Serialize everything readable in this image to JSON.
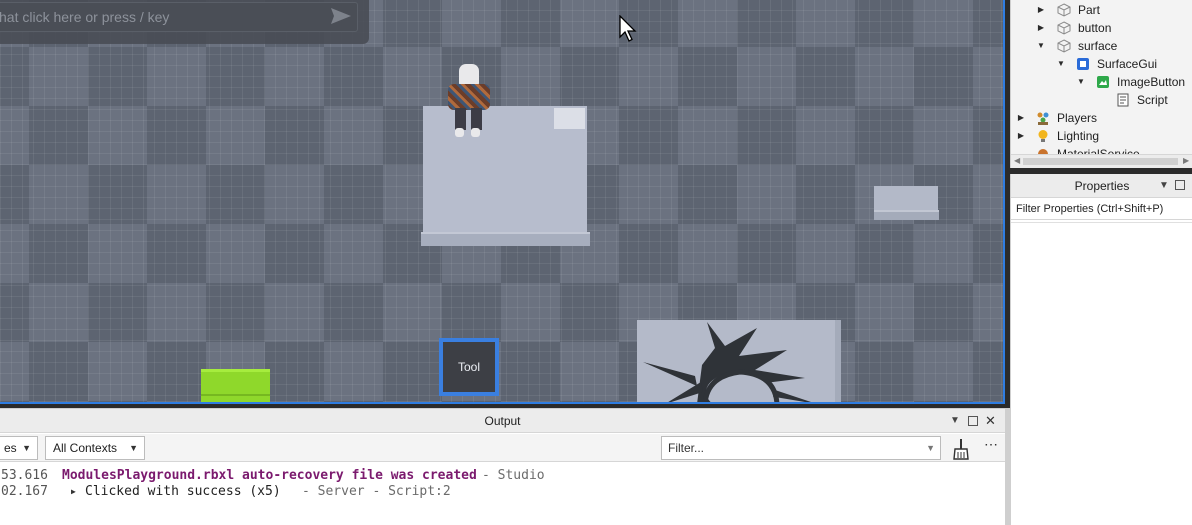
{
  "viewport": {
    "command_placeholder": "hat click here or press / key",
    "tool_slot_label": "Tool"
  },
  "explorer": {
    "items": [
      {
        "label": "Part",
        "icon": "part-icon",
        "expanded": false
      },
      {
        "label": "button",
        "icon": "part-icon",
        "expanded": false
      },
      {
        "label": "surface",
        "icon": "part-icon",
        "expanded": true
      },
      {
        "label": "SurfaceGui",
        "icon": "surfacegui-icon",
        "expanded": true
      },
      {
        "label": "ImageButton",
        "icon": "imagebutton-icon",
        "expanded": true
      },
      {
        "label": "Script",
        "icon": "script-icon",
        "expanded": false
      },
      {
        "label": "Players",
        "icon": "players-icon",
        "expanded": false
      },
      {
        "label": "Lighting",
        "icon": "lighting-icon",
        "expanded": false
      },
      {
        "label": "MaterialService",
        "icon": "materialservice-icon",
        "expanded": false
      }
    ]
  },
  "properties": {
    "title": "Properties",
    "filter_placeholder": "Filter Properties (Ctrl+Shift+P)"
  },
  "output": {
    "title": "Output",
    "level_dropdown": "es",
    "context_dropdown": "All Contexts",
    "filter_placeholder": "Filter...",
    "lines": [
      {
        "time": "53.616",
        "message": "ModulesPlayground.rbxl auto-recovery file was created",
        "source": "-  Studio"
      },
      {
        "time": "02.167",
        "message": "Clicked with success (x5)",
        "source": "-  Server - Script:2"
      }
    ]
  },
  "colors": {
    "selection_blue": "#2f7de1",
    "warning_purple": "#7b1a6e",
    "button_green": "#8fd82b"
  }
}
